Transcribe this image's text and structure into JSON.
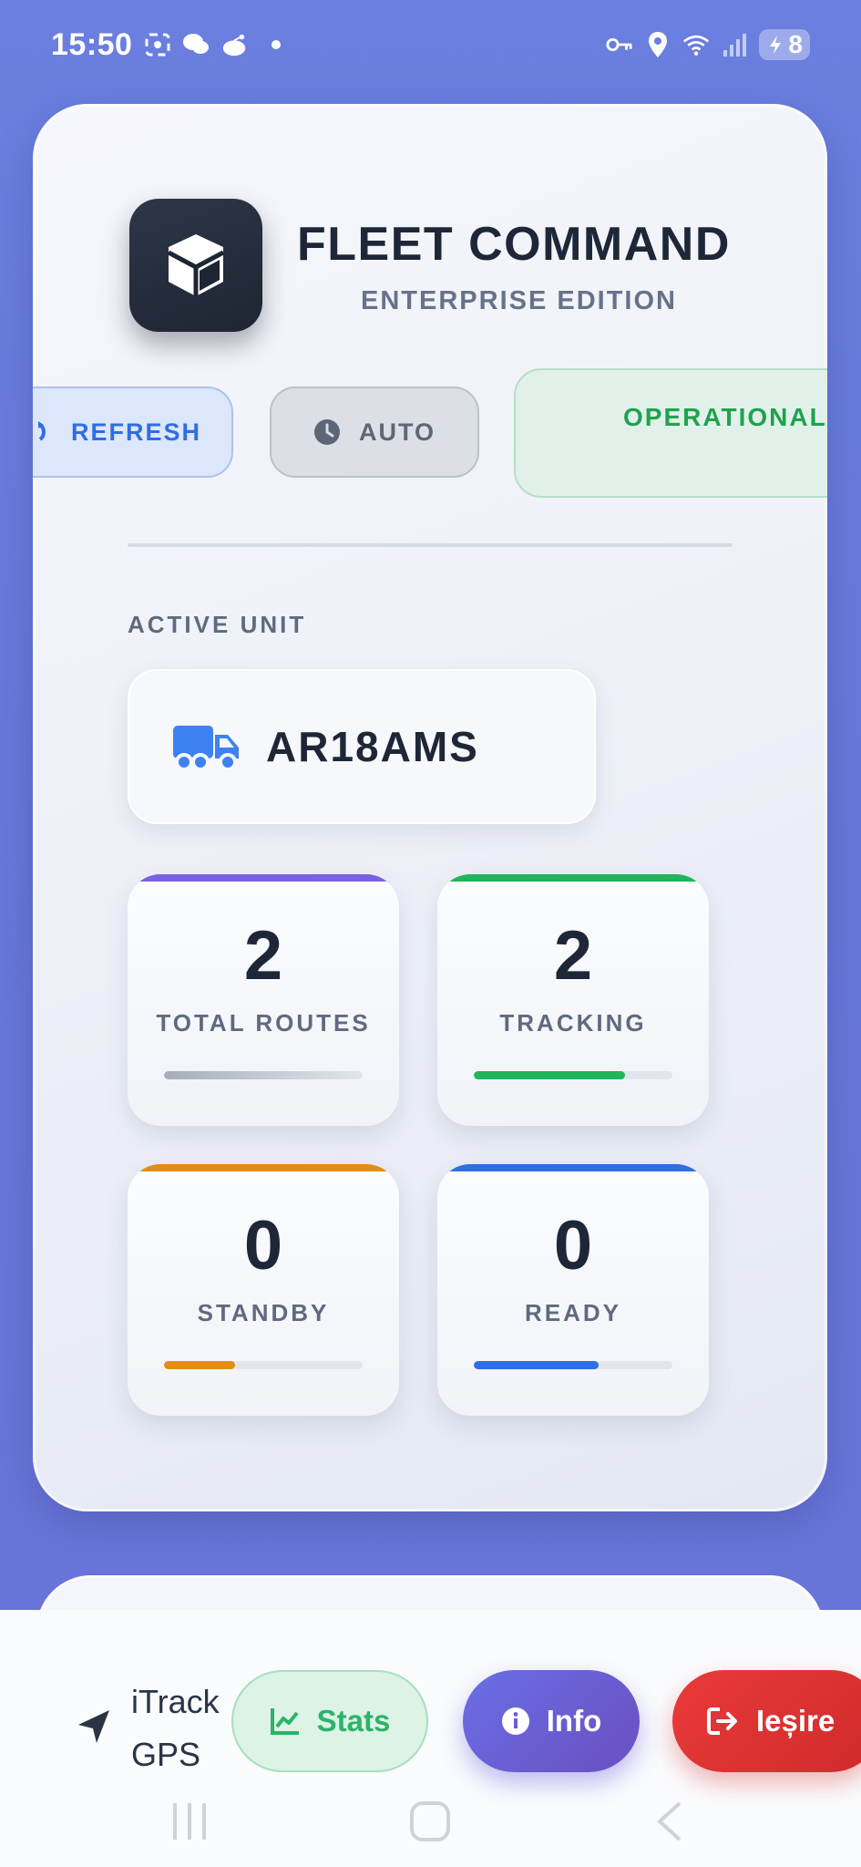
{
  "status_bar": {
    "time": "15:50",
    "battery": "8",
    "icons_left": [
      "screenshot-icon",
      "chat-icon",
      "reddit-icon",
      "dot-icon"
    ],
    "icons_right": [
      "key-icon",
      "location-icon",
      "wifi-icon",
      "signal-icon",
      "battery-icon"
    ]
  },
  "header": {
    "title": "FLEET COMMAND",
    "subtitle": "ENTERPRISE EDITION",
    "logo_icon": "cube-icon"
  },
  "controls": {
    "refresh_label": "REFRESH",
    "auto_label": "AUTO",
    "status_label": "OPERATIONAL"
  },
  "active_unit": {
    "section_label": "ACTIVE UNIT",
    "plate": "AR18AMS",
    "icon": "truck-icon"
  },
  "stats": [
    {
      "value": "2",
      "label": "TOTAL ROUTES",
      "progress": 1.0,
      "accent": "#7b61e0"
    },
    {
      "value": "2",
      "label": "TRACKING",
      "progress": 0.76,
      "accent": "#22b45a"
    },
    {
      "value": "0",
      "label": "STANDBY",
      "progress": 0.36,
      "accent": "#e58c16"
    },
    {
      "value": "0",
      "label": "READY",
      "progress": 0.63,
      "accent": "#2f6ee3"
    }
  ],
  "bottom_bar": {
    "brand_line1": "iTrack",
    "brand_line2": "GPS",
    "stats_label": "Stats",
    "info_label": "Info",
    "exit_label": "Ieșire"
  },
  "colors": {
    "background": "#6a7fdf",
    "primary_text": "#1e2738",
    "operational": "#1fa24e"
  }
}
